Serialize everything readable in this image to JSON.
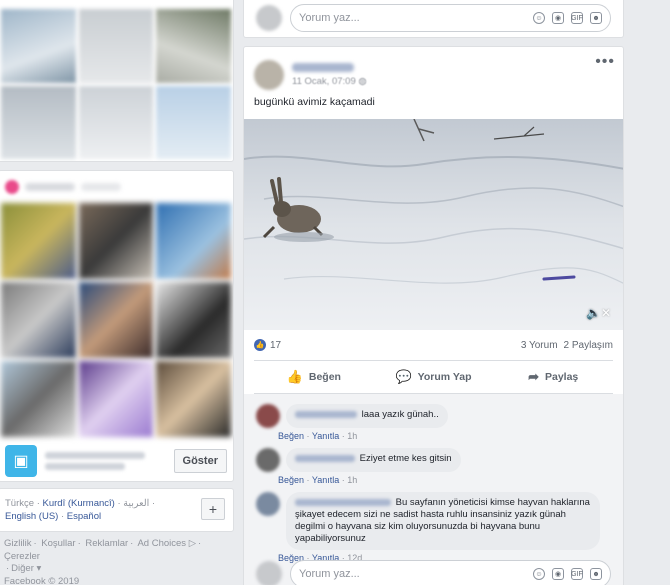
{
  "left_column": {
    "page_suggestion_button": "Göster",
    "languages": {
      "items": [
        "Türkçe",
        "Kurdî (Kurmancî)",
        "العربية",
        "English (US)",
        "Español"
      ],
      "add_label": "+"
    },
    "footer": {
      "links": [
        "Gizlilik",
        "Koşullar",
        "Reklamlar",
        "Ad Choices",
        "Çerezler",
        "Diğer"
      ],
      "copyright": "Facebook © 2019"
    }
  },
  "top_comment_box": {
    "placeholder": "Yorum yaz..."
  },
  "post": {
    "timestamp": "11 Ocak, 07:09",
    "text": "bugünkü avimiz kaçamadi",
    "reactions_count": "17",
    "comments_count": "3 Yorum",
    "shares_count": "2 Paylaşım",
    "actions": {
      "like": "Beğen",
      "comment": "Yorum Yap",
      "share": "Paylaş"
    },
    "comments": [
      {
        "text": "laaa yazık günah..",
        "like": "Beğen",
        "reply": "Yanıtla",
        "time": "1h"
      },
      {
        "text": "Eziyet etme kes gitsin",
        "like": "Beğen",
        "reply": "Yanıtla",
        "time": "1h"
      },
      {
        "text": "Bu sayfanın yöneticisi kimse hayvan haklarına şikayet edecem sizi ne sadist hasta ruhlu insansiniz yazık günah degilmi o hayvana siz kim oluyorsunuzda bi hayvana bunu yapabiliyorsunuz",
        "like": "Beğen",
        "reply": "Yanıtla",
        "time": "12d"
      }
    ],
    "comment_box": {
      "placeholder": "Yorum yaz..."
    }
  },
  "colors": {
    "link": "#385898",
    "brand": "#4267b2",
    "page_bg": "#e9ebee"
  },
  "icons": [
    "more-icon",
    "globe-icon",
    "like-icon",
    "comment-icon",
    "share-icon",
    "emoji-icon",
    "camera-icon",
    "gif-icon",
    "sticker-icon",
    "mute-icon",
    "plus-icon"
  ]
}
